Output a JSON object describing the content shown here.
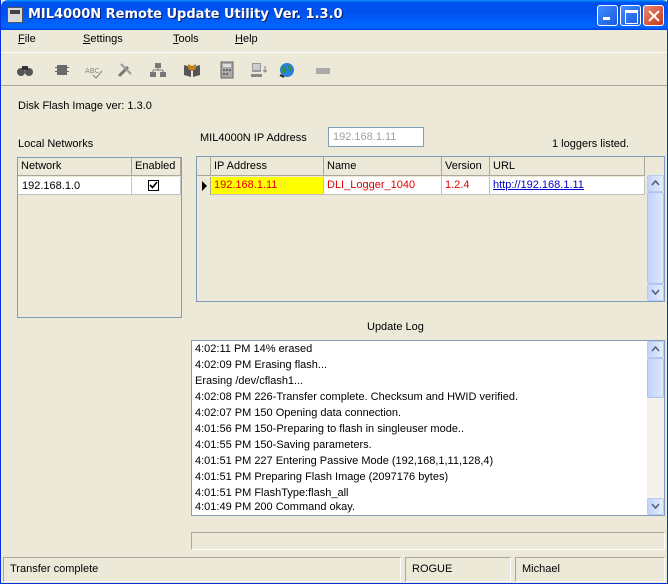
{
  "window": {
    "title": "MIL4000N Remote Update Utility Ver. 1.3.0"
  },
  "menu": {
    "file": "File",
    "settings": "Settings",
    "tools": "Tools",
    "help": "Help"
  },
  "toolbar": {
    "icons": [
      "binoculars-icon",
      "chip-icon",
      "spellcheck-icon",
      "tools-icon",
      "network-icon",
      "book-icon",
      "calculator-icon",
      "computer-icon",
      "globe-icon",
      "disk-icon"
    ]
  },
  "disk_flash_image": "Disk Flash Image ver: 1.3.0",
  "local_networks": {
    "title": "Local Networks",
    "headers": [
      "Network",
      "Enabled"
    ],
    "rows": [
      {
        "network": "192.168.1.0",
        "enabled": true
      }
    ]
  },
  "ip_field": {
    "label": "MIL4000N IP Address",
    "value": "192.168.1.11"
  },
  "loggers_count": "1 loggers listed.",
  "loggers_table": {
    "headers": [
      "IP Address",
      "Name",
      "Version",
      "URL"
    ],
    "rows": [
      {
        "ip": "192.168.1.11",
        "name": "DLI_Logger_1040",
        "version": "1.2.4",
        "url": "http://192.168.1.11"
      }
    ]
  },
  "update_log": {
    "title": "Update Log",
    "lines": [
      "4:02:11 PM 14% erased",
      "4:02:09 PM Erasing flash...",
      "Erasing /dev/cflash1...",
      "4:02:08 PM 226-Transfer complete. Checksum and HWID verified.",
      "4:02:07 PM 150 Opening data connection.",
      "4:01:56 PM 150-Preparing to flash in singleuser mode..",
      "4:01:55 PM 150-Saving parameters.",
      "4:01:51 PM 227 Entering Passive Mode (192,168,1,11,128,4)",
      "4:01:51 PM Preparing Flash Image (2097176 bytes)",
      "4:01:51 PM FlashType:flash_all",
      "4:01:49 PM 200 Command okay."
    ]
  },
  "status": {
    "message": "Transfer complete",
    "host": "ROGUE",
    "user": "Michael"
  },
  "colors": {
    "titlebar": "#0055e5",
    "row_text": "#e00000",
    "row_highlight": "#ffff00",
    "link": "#0000cc"
  }
}
